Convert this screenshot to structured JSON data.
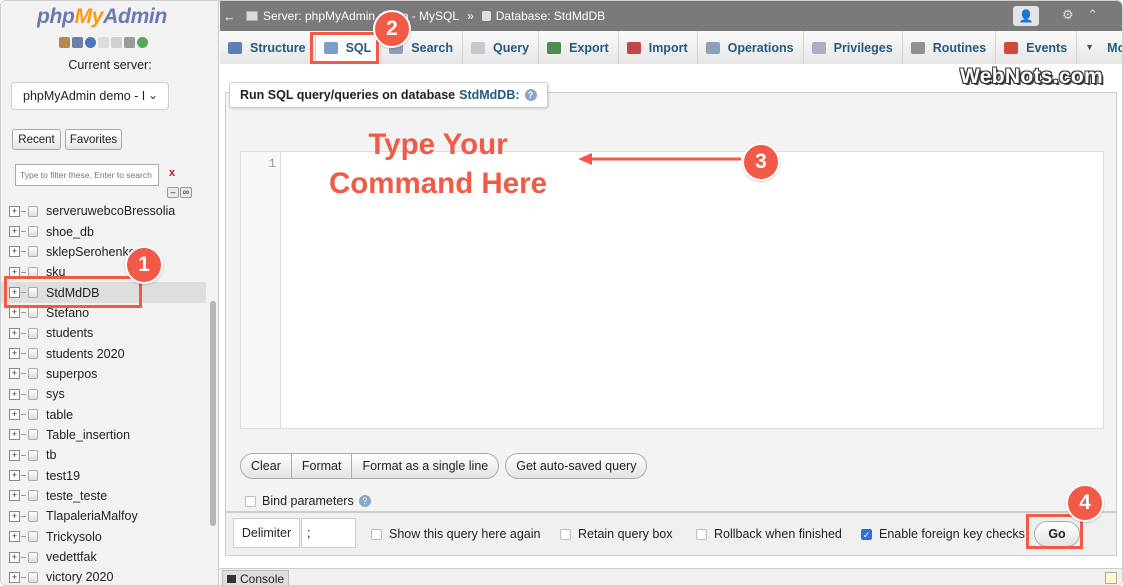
{
  "sidebar": {
    "logo": {
      "php": "php",
      "my": "My",
      "admin": "Admin"
    },
    "current_server_label": "Current server:",
    "server_select": "phpMyAdmin demo - I",
    "recent_label": "Recent",
    "favorites_label": "Favorites",
    "filter_placeholder": "Type to filter these, Enter to search",
    "filter_clear": "x",
    "databases": [
      {
        "name": "serveruwebcoBressolia"
      },
      {
        "name": "shoe_db"
      },
      {
        "name": "sklepSerohenko"
      },
      {
        "name": "sku"
      },
      {
        "name": "StdMdDB",
        "selected": true
      },
      {
        "name": "Stefano"
      },
      {
        "name": "students"
      },
      {
        "name": "students 2020"
      },
      {
        "name": "superpos"
      },
      {
        "name": "sys"
      },
      {
        "name": "table"
      },
      {
        "name": "Table_insertion"
      },
      {
        "name": "tb"
      },
      {
        "name": "test19"
      },
      {
        "name": "teste_teste"
      },
      {
        "name": "TlapaleriaMalfoy"
      },
      {
        "name": "Trickysolo"
      },
      {
        "name": "vedettfak"
      },
      {
        "name": "victory 2020"
      }
    ]
  },
  "topbar": {
    "back_arrow": "←",
    "server": "Server: phpMyAdmin demo - MySQL",
    "separator": "»",
    "database": "Database: StdMdDB",
    "right_icons": "⚙ ⌃"
  },
  "tabs": [
    {
      "label": "Structure",
      "icon": "structure-icon",
      "color": "#5a7fb0"
    },
    {
      "label": "SQL",
      "icon": "sql-icon",
      "color": "#7aa0c8",
      "active": true
    },
    {
      "label": "Search",
      "icon": "search-icon",
      "color": "#8d9fb8"
    },
    {
      "label": "Query",
      "icon": "query-icon",
      "color": "#c8c8c8"
    },
    {
      "label": "Export",
      "icon": "export-icon",
      "color": "#4e8c4e"
    },
    {
      "label": "Import",
      "icon": "import-icon",
      "color": "#c04848"
    },
    {
      "label": "Operations",
      "icon": "wrench-icon",
      "color": "#8ca0b8"
    },
    {
      "label": "Privileges",
      "icon": "privileges-icon",
      "color": "#a8b0bc"
    },
    {
      "label": "Routines",
      "icon": "routines-icon",
      "color": "#909090"
    },
    {
      "label": "Events",
      "icon": "clock-icon",
      "color": "#d04a3a"
    },
    {
      "label": "More",
      "icon": "caret-down-icon",
      "color": "#555555"
    }
  ],
  "watermark": "WebNots.com",
  "query": {
    "legend_prefix": "Run SQL query/queries on database",
    "database": "StdMdDB:",
    "line_number": "1",
    "buttons": {
      "clear": "Clear",
      "format": "Format",
      "format_single": "Format as a single line",
      "auto_saved": "Get auto-saved query"
    },
    "bind_parameters": "Bind parameters"
  },
  "bottom": {
    "delimiter_label": "Delimiter",
    "delimiter_value": ";",
    "show_query": "Show this query here again",
    "retain_box": "Retain query box",
    "rollback": "Rollback when finished",
    "foreign_keys": "Enable foreign key checks",
    "foreign_keys_checked": true,
    "go": "Go"
  },
  "console": {
    "label": "Console"
  },
  "annotation": {
    "text_line1": "Type Your",
    "text_line2": "Command Here",
    "badges": [
      "1",
      "2",
      "3",
      "4"
    ],
    "color": "#f05a47"
  }
}
